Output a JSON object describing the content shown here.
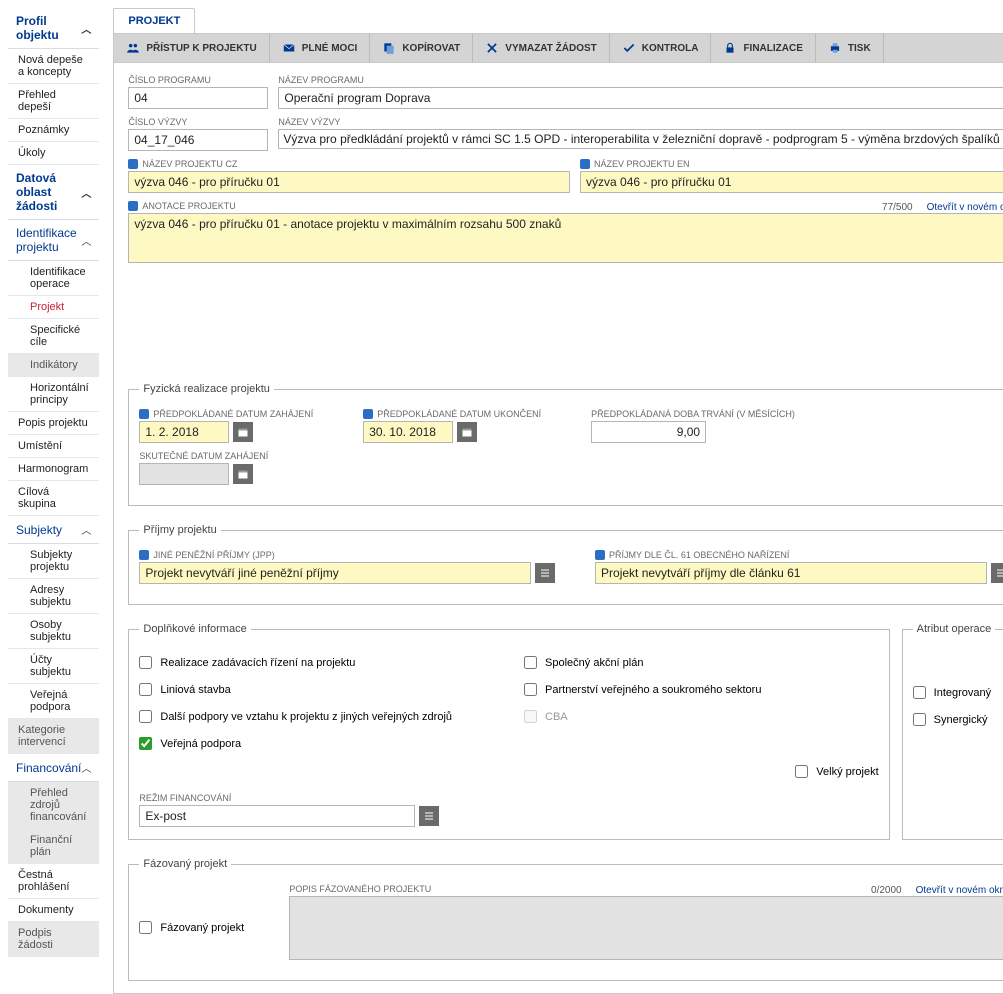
{
  "sidebar": {
    "h1": "Profil objektu",
    "i1": "Nová depeše a koncepty",
    "i2": "Přehled depeší",
    "i3": "Poznámky",
    "i4": "Úkoly",
    "h2": "Datová oblast žádosti",
    "h3": "Identifikace projektu",
    "s1": "Identifikace operace",
    "s2": "Projekt",
    "s3": "Specifické cíle",
    "s4": "Indikátory",
    "s5": "Horizontální principy",
    "i5": "Popis projektu",
    "i6": "Umístění",
    "i7": "Harmonogram",
    "i8": "Cílová skupina",
    "h4": "Subjekty",
    "s6": "Subjekty projektu",
    "s7": "Adresy subjektu",
    "s8": "Osoby subjektu",
    "s9": "Účty subjektu",
    "s10": "Veřejná podpora",
    "i9": "Kategorie intervencí",
    "h5": "Financování",
    "s11": "Přehled zdrojů financování",
    "s12": "Finanční plán",
    "i10": "Čestná prohlášení",
    "i11": "Dokumenty",
    "i12": "Podpis žádosti"
  },
  "tab": "PROJEKT",
  "toolbar": {
    "b1": "PŘÍSTUP K PROJEKTU",
    "b2": "PLNÉ MOCI",
    "b3": "KOPÍROVAT",
    "b4": "VYMAZAT ŽÁDOST",
    "b5": "KONTROLA",
    "b6": "FINALIZACE",
    "b7": "TISK"
  },
  "labels": {
    "cisloProg": "ČÍSLO PROGRAMU",
    "nazevProg": "NÁZEV PROGRAMU",
    "cisloVyz": "ČÍSLO VÝZVY",
    "nazevVyz": "NÁZEV VÝZVY",
    "nazCz": "NÁZEV PROJEKTU CZ",
    "nazEn": "NÁZEV PROJEKTU EN",
    "anot": "ANOTACE PROJEKTU",
    "fset1": "Fyzická realizace projektu",
    "dStart": "PŘEDPOKLÁDANÉ DATUM ZAHÁJENÍ",
    "dEnd": "PŘEDPOKLÁDANÉ DATUM UKONČENÍ",
    "doba": "PŘEDPOKLÁDANÁ DOBA TRVÁNÍ (V MĚSÍCÍCH)",
    "dReal": "SKUTEČNÉ DATUM ZAHÁJENÍ",
    "fset2": "Příjmy projektu",
    "jpp": "JINÉ PENĚŽNÍ PŘÍJMY (JPP)",
    "cl61": "PŘÍJMY DLE ČL. 61 OBECNÉHO NAŘÍZENÍ",
    "fset3": "Doplňkové informace",
    "fset4": "Atribut operace",
    "c1": "Realizace zadávacích řízení na projektu",
    "c2": "Liniová stavba",
    "c3": "Další podpory ve vztahu k projektu z jiných veřejných zdrojů",
    "c4": "Veřejná podpora",
    "c5": "Společný akční plán",
    "c6": "Partnerství veřejného a soukromého sektoru",
    "c7": "CBA",
    "c8": "Velký projekt",
    "a1": "Integrovaný",
    "a2": "Synergický",
    "rezim": "REŽIM FINANCOVÁNÍ",
    "fset5": "Fázovaný projekt",
    "popFaz": "POPIS FÁZOVANÉHO PROJEKTU",
    "openNew": "Otevřít v novém okně"
  },
  "values": {
    "cisloProg": "04",
    "nazevProg": "Operační program Doprava",
    "cisloVyz": "04_17_046",
    "nazevVyz": "Výzva pro předkládání projektů v rámci SC 1.5 OPD - interoperabilita v železniční dopravě - podprogram 5 - výměna brzdových špalíků u",
    "nazCz": "výzva 046 - pro příručku 01",
    "nazEn": "výzva 046 - pro příručku 01",
    "anot": "výzva 046 - pro příručku 01 - anotace projektu v maximálním rozsahu 500 znaků",
    "anotCnt": "77/500",
    "dStart": "1. 2. 2018",
    "dEnd": "30. 10. 2018",
    "doba": "9,00",
    "jpp": "Projekt nevytváří jiné peněžní příjmy",
    "cl61": "Projekt nevytváří příjmy dle článku 61",
    "rezim": "Ex-post",
    "fazCnt": "0/2000",
    "fazChk": "Fázovaný projekt"
  }
}
